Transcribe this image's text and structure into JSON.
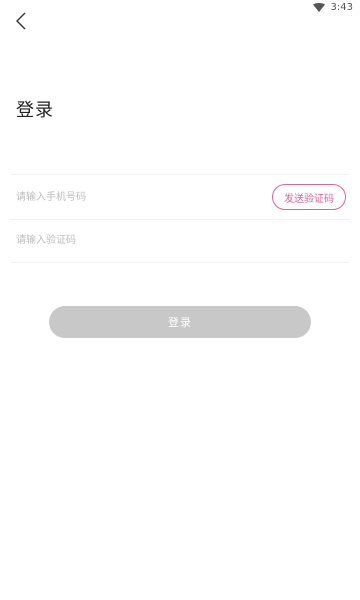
{
  "status_bar": {
    "time": "3:43",
    "wifi_icon": "wifi-icon"
  },
  "header": {
    "back_icon": "chevron-left-icon",
    "title": "登录"
  },
  "form": {
    "phone": {
      "value": "",
      "placeholder": "请输入手机号码"
    },
    "send_code_label": "发送验证码",
    "code": {
      "value": "",
      "placeholder": "请输入验证码"
    }
  },
  "login_button_label": "登录",
  "colors": {
    "accent": "#e4629c",
    "button_disabled": "#c8c8c8",
    "placeholder": "#bdbdbd",
    "divider": "#f1f1f1"
  }
}
